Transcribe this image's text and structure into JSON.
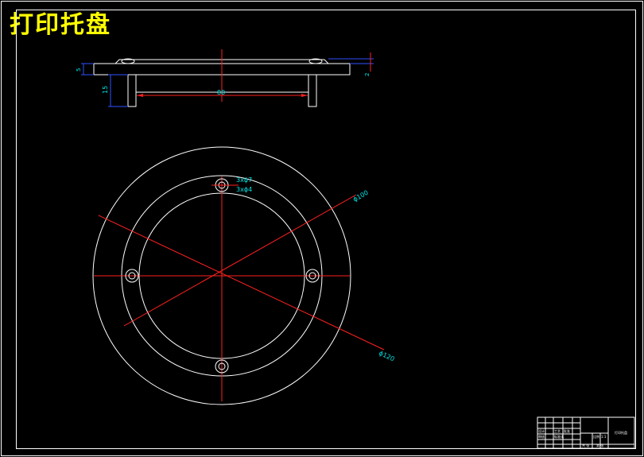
{
  "drawing": {
    "title": "打印托盘",
    "side_view": {
      "dim_thickness": "5",
      "dim_leg_height": "15",
      "dim_span": "80",
      "dim_step": "2"
    },
    "top_view": {
      "dim_outer": "ϕ120",
      "dim_inner": "ϕ100",
      "dim_hole": "3xϕ7",
      "dim_hole_2": "3xϕ4"
    },
    "title_block": {
      "name": "打印托盘",
      "cells": [
        "设计",
        "审核",
        "工艺",
        "标准化",
        "批准",
        "比例",
        "1:1",
        "共 张",
        "第 张"
      ]
    }
  }
}
